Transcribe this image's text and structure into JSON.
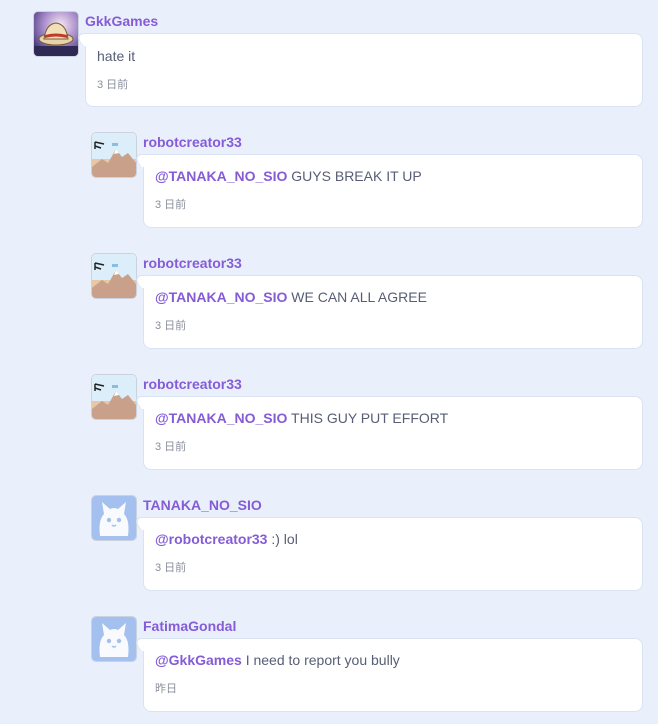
{
  "comments": [
    {
      "username": "GkkGames",
      "avatar": "planet-hat-avatar",
      "mention": "",
      "text": "hate it",
      "time": "3 日前"
    },
    {
      "username": "robotcreator33",
      "avatar": "mountain-landscape-avatar",
      "mention": "@TANAKA_NO_SIO",
      "text": " GUYS BREAK IT UP",
      "time": "3 日前"
    },
    {
      "username": "robotcreator33",
      "avatar": "mountain-landscape-avatar",
      "mention": "@TANAKA_NO_SIO",
      "text": " WE CAN ALL AGREE",
      "time": "3 日前"
    },
    {
      "username": "robotcreator33",
      "avatar": "mountain-landscape-avatar",
      "mention": "@TANAKA_NO_SIO",
      "text": " THIS GUY PUT EFFORT",
      "time": "3 日前"
    },
    {
      "username": "TANAKA_NO_SIO",
      "avatar": "default-cat-avatar",
      "mention": "@robotcreator33",
      "text": " :) lol",
      "time": "3 日前"
    },
    {
      "username": "FatimaGondal",
      "avatar": "default-cat-avatar",
      "mention": "@GkkGames",
      "text": " I need to report you bully",
      "time": "昨日"
    }
  ],
  "colors": {
    "background": "#e9f0fc",
    "username": "#855cd6",
    "text": "#575e75",
    "timestamp": "#8a8f9c",
    "bubble_border": "#d9e3f2"
  }
}
